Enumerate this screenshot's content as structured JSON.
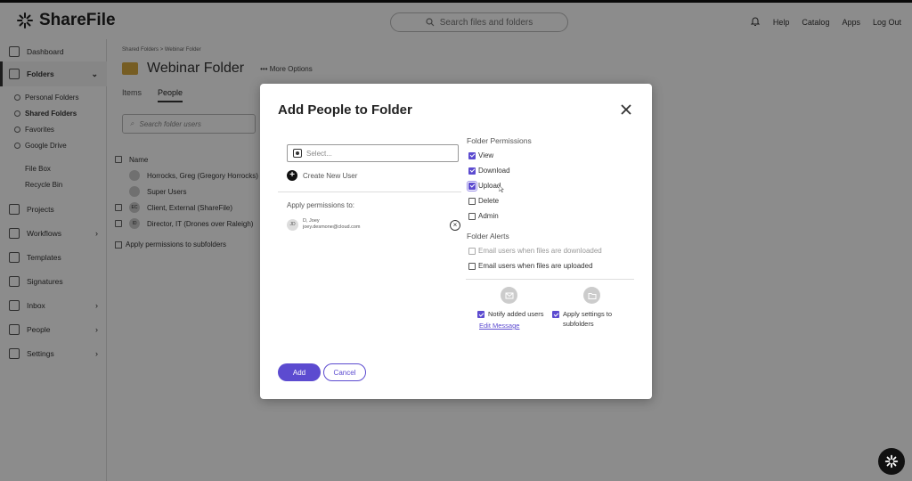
{
  "app": {
    "brand": "ShareFile",
    "search_placeholder": "Search files and folders",
    "top_links": [
      "Help",
      "Catalog",
      "Apps",
      "Log Out"
    ]
  },
  "sidebar": {
    "items": [
      {
        "label": "Dashboard",
        "icon": "dashboard-icon"
      },
      {
        "label": "Folders",
        "icon": "folder-icon",
        "chevron": "⌄"
      },
      {
        "label": "Projects",
        "icon": "projects-icon"
      },
      {
        "label": "Workflows",
        "icon": "workflows-icon",
        "chevron": "›"
      },
      {
        "label": "Templates",
        "icon": "templates-icon"
      },
      {
        "label": "Signatures",
        "icon": "signature-icon"
      },
      {
        "label": "Inbox",
        "icon": "inbox-icon",
        "chevron": "›"
      },
      {
        "label": "People",
        "icon": "people-icon",
        "chevron": "›"
      },
      {
        "label": "Settings",
        "icon": "gear-icon",
        "chevron": "›"
      }
    ],
    "folder_sub": [
      "Personal Folders",
      "Shared Folders",
      "Favorites",
      "Google Drive"
    ],
    "folder_sub2": [
      "File Box",
      "Recycle Bin"
    ]
  },
  "content": {
    "breadcrumb": "Shared Folders  >  Webinar Folder",
    "title": "Webinar Folder",
    "more_options": "More Options",
    "tabs": [
      "Items",
      "People"
    ],
    "search_placeholder": "Search folder users",
    "column_name": "Name",
    "people": [
      {
        "initials": "",
        "name": "Horrocks, Greg (Gregory Horrocks) (own"
      },
      {
        "initials": "",
        "name": "Super Users"
      },
      {
        "initials": "EC",
        "name": "Client, External (ShareFile)"
      },
      {
        "initials": "ID",
        "name": "Director, IT (Drones over Raleigh)"
      }
    ],
    "apply_subfolders": "Apply permissions to subfolders"
  },
  "modal": {
    "title": "Add People to Folder",
    "select_placeholder": "Select...",
    "create_user": "Create New User",
    "apply_to_label": "Apply permissions to:",
    "user": {
      "initials": "JD",
      "name": "D, Joey",
      "email": "joey.desmone@cloud.com"
    },
    "folder_permissions_label": "Folder Permissions",
    "permissions": [
      {
        "label": "View",
        "checked": true
      },
      {
        "label": "Download",
        "checked": true
      },
      {
        "label": "Upload",
        "checked": true
      },
      {
        "label": "Delete",
        "checked": false
      },
      {
        "label": "Admin",
        "checked": false
      }
    ],
    "folder_alerts_label": "Folder Alerts",
    "alerts": [
      {
        "label": "Email users when files are downloaded",
        "checked": false,
        "disabled": true
      },
      {
        "label": "Email users when files are uploaded",
        "checked": false,
        "disabled": false
      }
    ],
    "notify_label": "Notify added users",
    "edit_message": "Edit Message",
    "apply_settings_label_1": "Apply settings to",
    "apply_settings_label_2": "subfolders",
    "add_button": "Add",
    "cancel_button": "Cancel"
  },
  "colors": {
    "accent": "#5c4bd0",
    "folder": "#d8a941"
  }
}
